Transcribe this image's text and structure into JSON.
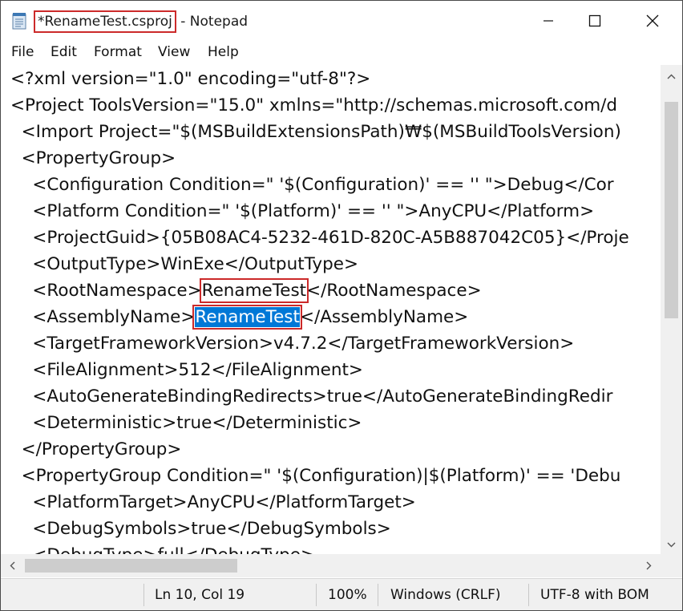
{
  "window": {
    "title_file": "*RenameTest.csproj",
    "title_suffix": " - Notepad"
  },
  "menu": {
    "file": "File",
    "edit": "Edit",
    "format": "Format",
    "view": "View",
    "help": "Help"
  },
  "editor": {
    "lines": [
      "<?xml version=\"1.0\" encoding=\"utf-8\"?>",
      "<Project ToolsVersion=\"15.0\" xmlns=\"http://schemas.microsoft.com/d",
      "  <Import Project=\"$(MSBuildExtensionsPath)₩$(MSBuildToolsVersion)",
      "  <PropertyGroup>",
      "    <Configuration Condition=\" '$(Configuration)' == '' \">Debug</Cor",
      "    <Platform Condition=\" '$(Platform)' == '' \">AnyCPU</Platform>",
      "    <ProjectGuid>{05B08AC4-5232-461D-820C-A5B887042C05}</Proje",
      "    <OutputType>WinExe</OutputType>",
      {
        "prefix": "    <RootNamespace>",
        "value": "RenameTest",
        "suffix": "</RootNamespace>"
      },
      {
        "prefix": "    <AssemblyName>",
        "value": "RenameTest",
        "suffix": "</AssemblyName>"
      },
      "    <TargetFrameworkVersion>v4.7.2</TargetFrameworkVersion>",
      "    <FileAlignment>512</FileAlignment>",
      "    <AutoGenerateBindingRedirects>true</AutoGenerateBindingRedir",
      "    <Deterministic>true</Deterministic>",
      "  </PropertyGroup>",
      "  <PropertyGroup Condition=\" '$(Configuration)|$(Platform)' == 'Debu",
      "    <PlatformTarget>AnyCPU</PlatformTarget>",
      "    <DebugSymbols>true</DebugSymbols>",
      "    <DebugType>full</DebugType>"
    ]
  },
  "status": {
    "position": "Ln 10, Col 19",
    "zoom": "100%",
    "line_ending": "Windows (CRLF)",
    "encoding": "UTF-8 with BOM"
  },
  "colors": {
    "selection": "#0078d7",
    "highlight_box": "#cc2a2a"
  }
}
